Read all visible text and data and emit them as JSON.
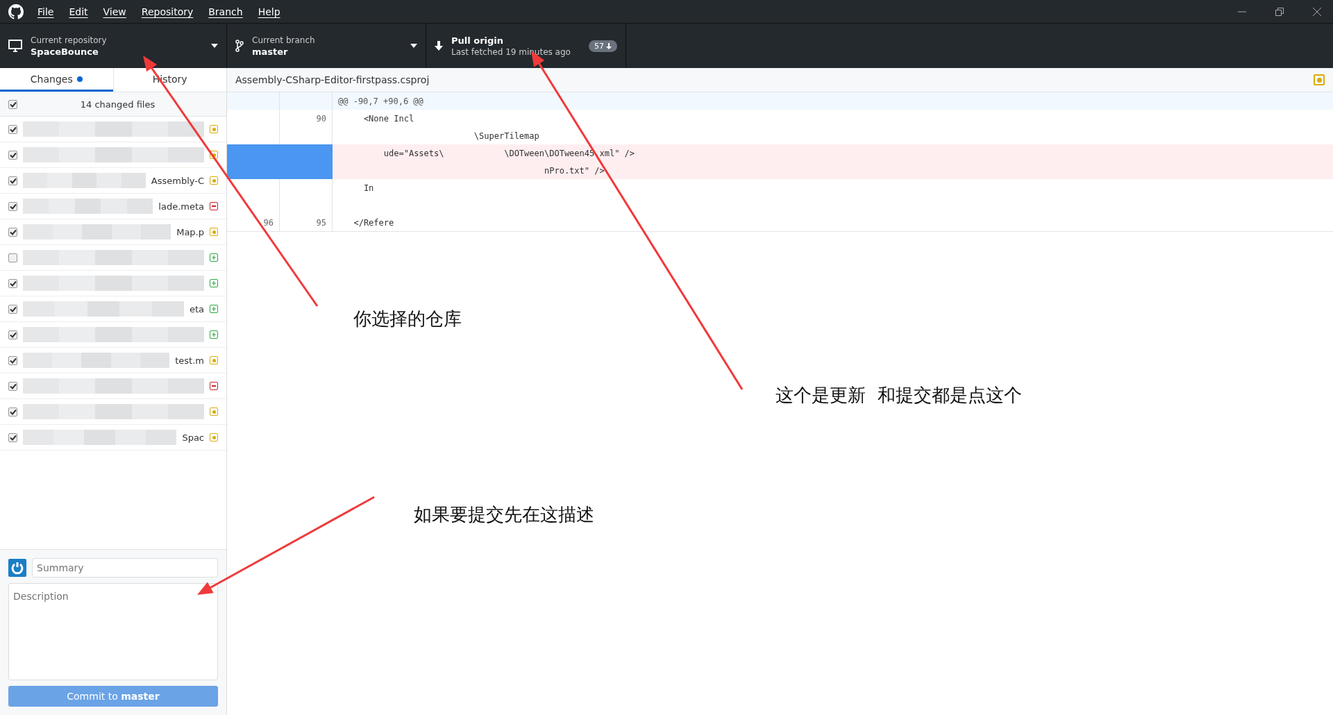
{
  "menu": [
    "File",
    "Edit",
    "View",
    "Repository",
    "Branch",
    "Help"
  ],
  "toolbar": {
    "repository": {
      "label": "Current repository",
      "value": "SpaceBounce"
    },
    "branch": {
      "label": "Current branch",
      "value": "master"
    },
    "pull": {
      "label": "Pull origin",
      "detail": "Last fetched 19 minutes ago",
      "badge": "57"
    }
  },
  "tabs": [
    {
      "label": "Changes",
      "selected": true,
      "dot": true
    },
    {
      "label": "History",
      "selected": false,
      "dot": false
    }
  ],
  "changes": {
    "summary": "14 changed files",
    "all_checked": true,
    "files": [
      {
        "checked": true,
        "kind": "modified"
      },
      {
        "checked": true,
        "kind": "modified"
      },
      {
        "name": "Assembly-C",
        "checked": true,
        "kind": "modified"
      },
      {
        "name": "lade.meta",
        "checked": true,
        "kind": "deleted"
      },
      {
        "name": "Map.p",
        "checked": true,
        "kind": "modified"
      },
      {
        "checked": false,
        "kind": "added"
      },
      {
        "checked": true,
        "kind": "added"
      },
      {
        "name": "eta",
        "checked": true,
        "kind": "added"
      },
      {
        "checked": true,
        "kind": "added"
      },
      {
        "name": "test.m",
        "checked": true,
        "kind": "modified"
      },
      {
        "checked": true,
        "kind": "deleted"
      },
      {
        "checked": true,
        "kind": "modified"
      },
      {
        "name": "Spac",
        "checked": true,
        "kind": "modified"
      }
    ]
  },
  "commit": {
    "summary_placeholder": "Summary",
    "description_placeholder": "Description",
    "button": "Commit to **master**"
  },
  "diff": {
    "file": "Assembly-CSharp-Editor-firstpass.csproj",
    "hunk": "@@ -90,7 +90,6 @@",
    "lines": [
      {
        "new": "90",
        "kind": "context",
        "text": "    <None Incl"
      },
      {
        "kind": "context",
        "text": "                          \\SuperTilemap"
      },
      {
        "kind": "deleted",
        "text": "        ude=\"Assets\\            \\DOTween\\DOTween45.xml\" />"
      },
      {
        "kind": "deleted",
        "text": "                                        nPro.txt\" />"
      },
      {
        "kind": "context",
        "text": "    In"
      },
      {
        "kind": "context"
      },
      {
        "old": "96",
        "new": "95",
        "kind": "context",
        "text": "  </Refere"
      }
    ]
  },
  "annotations": [
    {
      "text": "你选择的仓库"
    },
    {
      "text": "这个是更新  和提交都是点这个"
    },
    {
      "text": "如果要提交先在这描述"
    }
  ]
}
